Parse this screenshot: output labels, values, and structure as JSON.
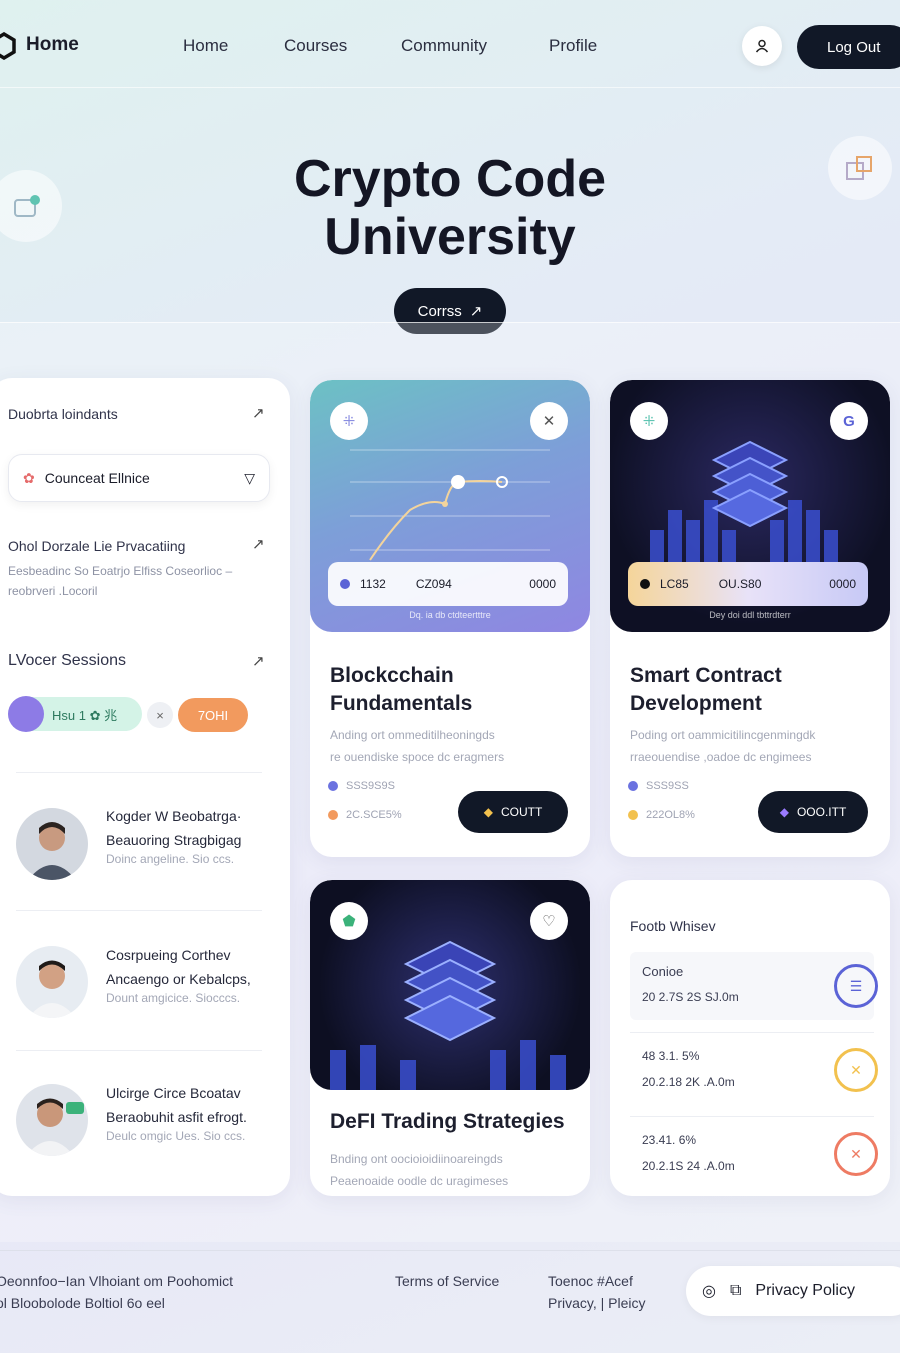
{
  "nav": {
    "brand": "Home",
    "links": [
      "Home",
      "Courses",
      "Community",
      "Profile"
    ],
    "logout_label": "Log Out"
  },
  "hero": {
    "title_line1": "Crypto Code",
    "title_line2": "University",
    "button_label": "Corrss"
  },
  "sidebar": {
    "section1_title": "Duobrta loindants",
    "dropdown_value": "Counceat Ellnice",
    "section2_title": "Ohol Dorzale Lie Prvacatiing",
    "section2_desc1": "Eesbeadinc So Eoatrjo Elfiss Coseorlioc –",
    "section2_desc2": "reobrveri .Locoril",
    "section3_title": "LVocer Sessions",
    "pill_green": "Hsu 1 ✿ 兆",
    "pill_x": "×",
    "pill_orange": "7OHI",
    "sessions": [
      {
        "line1": "Kogder W Beobatrga·",
        "line2": "Beauoring Stragbigag",
        "meta": "Doinc angeline. Sio ccs."
      },
      {
        "line1": "Cosrpueing Corthev",
        "line2": "Ancaengo or Kebalcps,",
        "meta": "Dount amgicice. Siocccs."
      },
      {
        "line1": "Ulcirge Circe Bcoatav",
        "line2": "Beraobuhit asfit efrogt.",
        "meta": "Deulc omgic Ues. Sio ccs."
      }
    ]
  },
  "cards": [
    {
      "title_line1": "Blockcchain",
      "title_line2": "Fundamentals",
      "desc1": "Anding ort ommeditilheoningds",
      "desc2": "re ouendiske spoce dc eragmers",
      "stat1": "SSS9S9S",
      "stat2": "2C.SCE5%",
      "button_label": "COUTT",
      "bar": [
        "1132",
        "CZ094",
        "0000"
      ],
      "bar_caption": "Dq. ia db ctdteertttre"
    },
    {
      "title_line1": "Smart Contract",
      "title_line2": "Development",
      "desc1": "Poding ort oammicitilincgenmingdk",
      "desc2": "rraeouendise ,oadoe dc engimees",
      "stat1": "SSS9SS",
      "stat2": "222OL8%",
      "button_label": "OOO.ITT",
      "bar": [
        "LC85",
        "OU.S80",
        "0000"
      ],
      "bar_caption": "Dey doi ddl tbttrdterr"
    },
    {
      "title": "DeFI Trading Strategies",
      "desc1": "Bnding ont oocioioidiinoareingds",
      "desc2": "Peaenoaide oodle dc uragimeses"
    }
  ],
  "panel": {
    "title": "Footb Whisev",
    "rows": [
      {
        "line1": "Conioe",
        "line2": "20 2.7S 2S SJ.0m",
        "color": "#5b63d6",
        "icon": "list-icon"
      },
      {
        "line1": "48 3.1. 5%",
        "line2": "20.2.18 2K .A.0m",
        "color": "#f2c14e",
        "icon": "close-icon"
      },
      {
        "line1": "23.41. 6%",
        "line2": "20.2.1S 24 .A.0m",
        "color": "#ee7b63",
        "icon": "close-icon"
      }
    ]
  },
  "footer": {
    "left1": "Oeonnfoo−Ian Vlhoiant om Poohomict",
    "left2": "ol Bloobolode Boltiol 6o eel",
    "terms": "Terms of Service",
    "mid1": "Toenoc #Acef",
    "mid2": "Privacy,",
    "mid3": "Pleicy",
    "privacy": "Privacy Policy"
  },
  "colors": {
    "dark": "#111827",
    "accent_blue": "#5b63d6",
    "accent_orange": "#f29a5e"
  }
}
